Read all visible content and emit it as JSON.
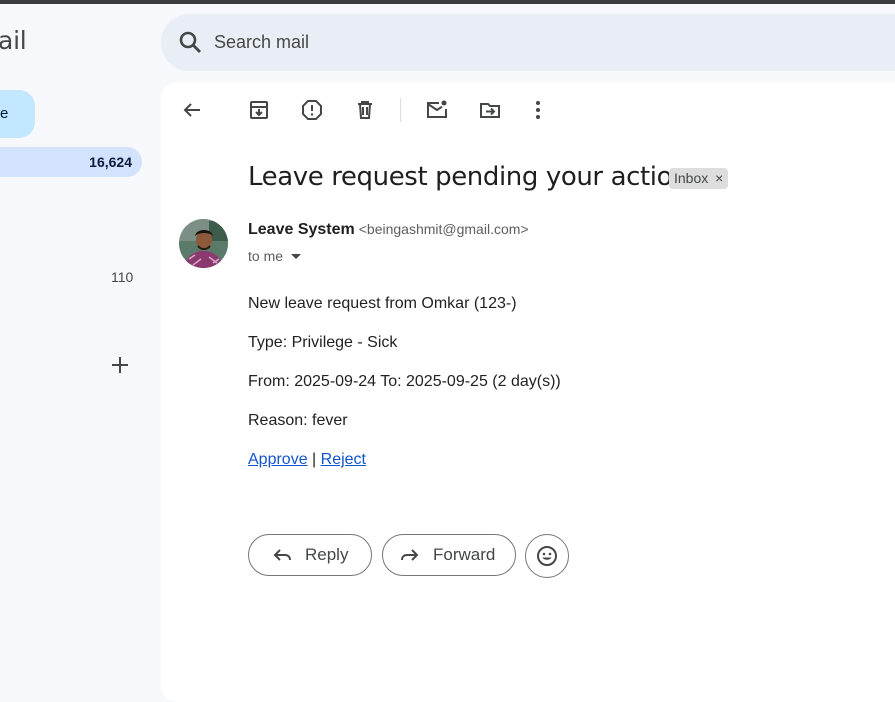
{
  "app": {
    "logo_text": "Gmail"
  },
  "sidebar": {
    "compose_label": "Compose",
    "inbox_count": "16,624",
    "secondary_count": "110"
  },
  "search": {
    "placeholder": "Search mail"
  },
  "toolbar": {
    "icons": [
      "back-arrow-icon",
      "archive-icon",
      "report-spam-icon",
      "delete-icon",
      "mark-unread-icon",
      "move-to-icon",
      "more-vert-icon"
    ]
  },
  "message": {
    "subject": "Leave request pending your action",
    "label": "Inbox",
    "label_remove": "×",
    "sender_name": "Leave System",
    "sender_email": "<beingashmit@gmail.com>",
    "to_line": "to me",
    "body": {
      "line1": "New leave request from Omkar (123-)",
      "line2": "Type: Privilege - Sick",
      "line3": "From: 2025-09-24 To: 2025-09-25 (2 day(s))",
      "line4": "Reason: fever",
      "approve": "Approve",
      "separator": " | ",
      "reject": "Reject"
    }
  },
  "actions": {
    "reply": "Reply",
    "forward": "Forward"
  },
  "colors": {
    "accent": "#c2e7ff",
    "selected": "#d3e3fd",
    "link": "#1155cc",
    "search_bg": "#e9eef6"
  }
}
